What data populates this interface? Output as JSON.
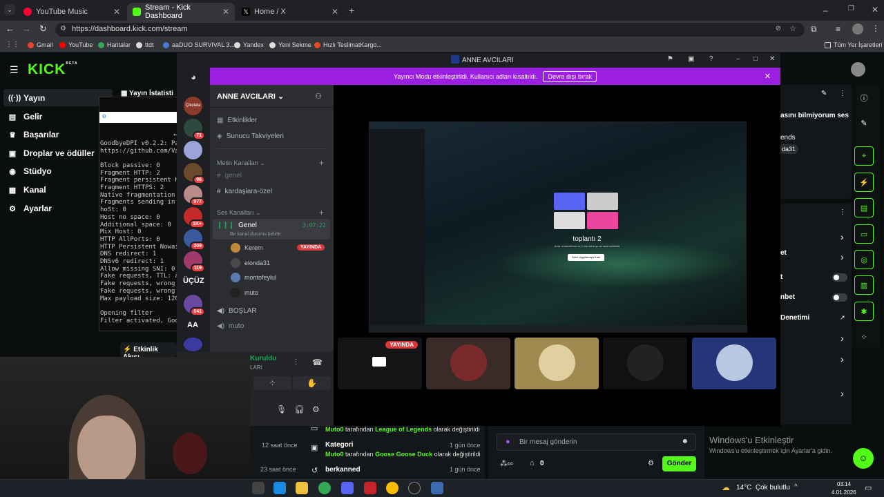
{
  "browser": {
    "tabs": [
      {
        "label": "YouTube Music",
        "icon": "youtube-music-icon",
        "color": "#ff0033"
      },
      {
        "label": "Stream - Kick Dashboard",
        "icon": "kick-icon",
        "color": "#53fc18"
      },
      {
        "label": "Home / X",
        "icon": "x-icon",
        "color": "#ffffff"
      }
    ],
    "url": "https://dashboard.kick.com/stream",
    "bookmarks": [
      "Gmail",
      "YouTube",
      "Haritalar",
      "ttdt",
      "aaDUO SURVIVAL 3...",
      "Yandex",
      "Yeni Sekme",
      "Hızlı TeslimatKargo..."
    ],
    "all_bookmarks": "Tüm Yer İşaretleri"
  },
  "kick": {
    "logo": "KICK",
    "logo_sup": "BETA",
    "nav": [
      {
        "label": "Yayın",
        "icon": "broadcast-icon"
      },
      {
        "label": "Gelir",
        "icon": "revenue-icon"
      },
      {
        "label": "Başarılar",
        "icon": "trophy-icon"
      },
      {
        "label": "Droplar ve ödüller",
        "icon": "gift-icon"
      },
      {
        "label": "Stüdyo",
        "icon": "studio-icon"
      },
      {
        "label": "Kanal",
        "icon": "channel-icon"
      },
      {
        "label": "Ayarlar",
        "icon": "gear-icon"
      }
    ],
    "stats_tab": "Yayın İstatisti",
    "activity_tab": "Etkinlik Akışı",
    "right_texts": [
      "asını bilmiyorum ses",
      "ends",
      "da31",
      "et",
      "t",
      "nbet",
      "Denetimi"
    ],
    "feed": [
      {
        "user": "Muto0",
        "mid": "tarafından",
        "value": "League of Legends",
        "suffix": "olarak değiştirildi",
        "time": ""
      },
      {
        "title": "Kategori",
        "user": "Muto0",
        "mid": "tarafından",
        "value": "Goose Goose Duck",
        "suffix": "olarak değiştirildi",
        "time": "1 gün önce"
      },
      {
        "title": "berkanned",
        "time": "1 gün önce"
      }
    ],
    "feed_left_times": [
      "12 saat önce",
      "23 saat önce"
    ],
    "chat_placeholder": "Bir mesaj gönderin",
    "send": "Gönder",
    "points": "0",
    "activate_windows": "Windows'u Etkinleştir",
    "activate_windows_sub": "Windows'u etkinleştirmek için Ayarlar'a gidin."
  },
  "terminal": {
    "lines": [
      "GoodbyeDPI v0.2.2: Pa",
      "https://github.com/Va",
      "",
      "Block passive: 0",
      "Fragment HTTP: 2",
      "Fragment persistent H",
      "Fragment HTTPS: 2",
      "Native fragmentation",
      "Fragments sending in",
      "hoSt: 0",
      "Host no space: 0",
      "Additional space: 0",
      "Mix Host: 0",
      "HTTP AllPorts: 0",
      "HTTP Persistent Nowai",
      "DNS redirect: 1",
      "DNSv6 redirect: 1",
      "Allow missing SNI: 0",
      "Fake requests, TTL: a",
      "Fake requests, wrong",
      "Fake requests, wrong",
      "Max payload size: 120",
      "",
      "Opening filter",
      "Filter activated, Goo"
    ]
  },
  "discord": {
    "window_title": "ANNE AVCILARI",
    "banner_text": "Yayıncı Modu etkinleştirildi. Kullanıcı adları kısaltıldı.",
    "banner_button": "Devre dışı bırak",
    "server_name": "ANNE AVCILARI",
    "events": "Etkinlikler",
    "boosts": "Sunucu Takviyeleri",
    "text_category": "Metin Kanalları",
    "text_channels": [
      "genel",
      "kardaşlara-özel"
    ],
    "voice_category": "Ses Kanalları",
    "voice_channel": "Genel",
    "voice_timer": "3:07:22",
    "voice_status": "Bir kanal durumu belirle",
    "voice_users": [
      "Kerem",
      "elonda31",
      "montofeylul",
      "muto"
    ],
    "live_badge": "YAYINDA",
    "other_voice": [
      "BOŞLAR",
      "muto"
    ],
    "server_badges": [
      "71",
      "86",
      "977",
      "1K+",
      "209",
      "119",
      "641"
    ],
    "server_text_icons": [
      "ÜÇÜZ",
      "AA"
    ],
    "server_top_label": "Çikolata",
    "connected": "Kuruldu",
    "connected_sub": "LARI",
    "share": {
      "title": "toplantı 2",
      "subtitle": "Arda, ebamafimud ve 2 kişi daha şu an sesli sohbette",
      "button": "Sesli Uygulamaya Katıl"
    }
  },
  "taskbar": {
    "weather": "14°C  Çok bulutlu",
    "time": "03:14",
    "date": "4.01.2026"
  }
}
